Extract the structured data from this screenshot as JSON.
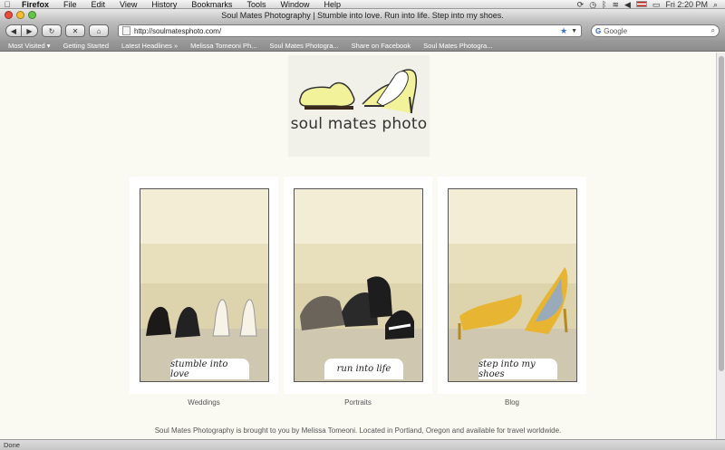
{
  "menubar": {
    "apple": "",
    "app": "Firefox",
    "items": [
      "File",
      "Edit",
      "View",
      "History",
      "Bookmarks",
      "Tools",
      "Window",
      "Help"
    ],
    "clock": "Fri 2:20 PM"
  },
  "window": {
    "title": "Soul Mates Photography | Stumble into love. Run into life. Step into my shoes."
  },
  "toolbar": {
    "url": "http://soulmatesphoto.com/",
    "search_placeholder": "Google"
  },
  "bookmarks": [
    "Most Visited ▾",
    "Getting Started",
    "Latest Headlines »",
    "Melissa Tomeoni Ph...",
    "Soul Mates Photogra...",
    "Share on Facebook",
    "Soul Mates Photogra..."
  ],
  "site": {
    "logo_text": "soul mates photo",
    "cards": [
      {
        "caption": "stumble into love",
        "label": "Weddings"
      },
      {
        "caption": "run into life",
        "label": "Portraits"
      },
      {
        "caption": "step into my shoes",
        "label": "Blog"
      }
    ],
    "footer": "Soul Mates Photography is brought to you by Melissa Tomeoni. Located in Portland, Oregon and available for travel worldwide."
  },
  "status": "Done",
  "colors": {
    "page_bg": "#fafaf3",
    "shoe_yellow": "#f2f29a"
  }
}
